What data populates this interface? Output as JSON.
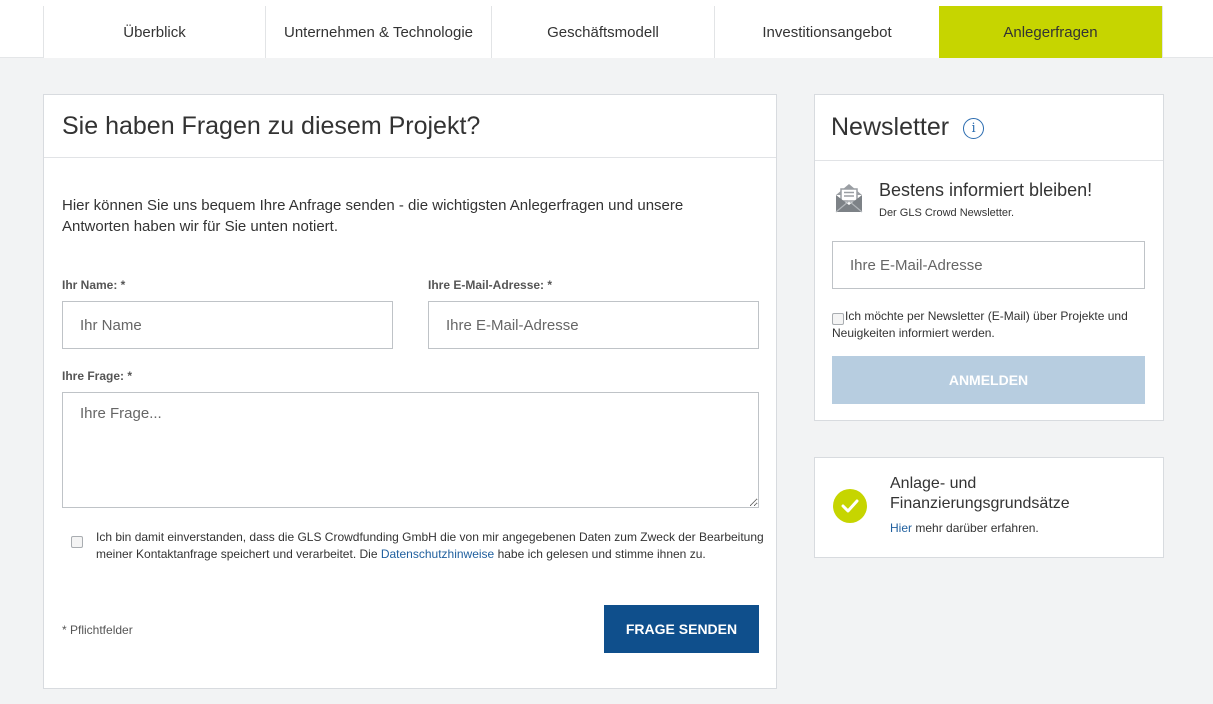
{
  "tabs": [
    {
      "label": "Überblick"
    },
    {
      "label": "Unternehmen & Technologie"
    },
    {
      "label": "Geschäftsmodell"
    },
    {
      "label": "Investitionsangebot"
    },
    {
      "label": "Anlegerfragen",
      "active": true
    }
  ],
  "question_form": {
    "title": "Sie haben Fragen zu diesem Projekt?",
    "intro": "Hier können Sie uns bequem Ihre Anfrage senden - die wichtigsten Anlegerfragen und unsere Antworten haben wir für Sie unten notiert.",
    "name_label": "Ihr Name: *",
    "name_placeholder": "Ihr Name",
    "email_label": "Ihre E-Mail-Adresse: *",
    "email_placeholder": "Ihre E-Mail-Adresse",
    "question_label": "Ihre Frage: *",
    "question_placeholder": "Ihre Frage...",
    "consent_text_before": "Ich bin damit einverstanden, dass die GLS Crowdfunding GmbH die von mir angegebenen Daten zum Zweck der Bearbeitung meiner Kontaktanfrage speichert und verarbeitet. Die ",
    "consent_link": "Datenschutzhinweise",
    "consent_text_after": " habe ich gelesen und stimme ihnen zu.",
    "required_note": "* Pflichtfelder",
    "submit_label": "FRAGE SENDEN"
  },
  "newsletter": {
    "title": "Newsletter",
    "info_icon": "i",
    "headline": "Bestens informiert bleiben!",
    "subline": "Der GLS Crowd Newsletter.",
    "email_placeholder": "Ihre E-Mail-Adresse",
    "consent": "Ich möchte per Newsletter (E-Mail) über Projekte und Neuigkeiten informiert werden.",
    "submit_label": "ANMELDEN"
  },
  "principles": {
    "title": "Anlage- und Finanzierungsgrundsätze",
    "link": "Hier",
    "more_text": " mehr darüber erfahren."
  },
  "colors": {
    "accent_green": "#c6d500",
    "primary_blue": "#0f4f8c",
    "disabled_blue": "#b7cde0",
    "link_blue": "#1f5f9e"
  }
}
